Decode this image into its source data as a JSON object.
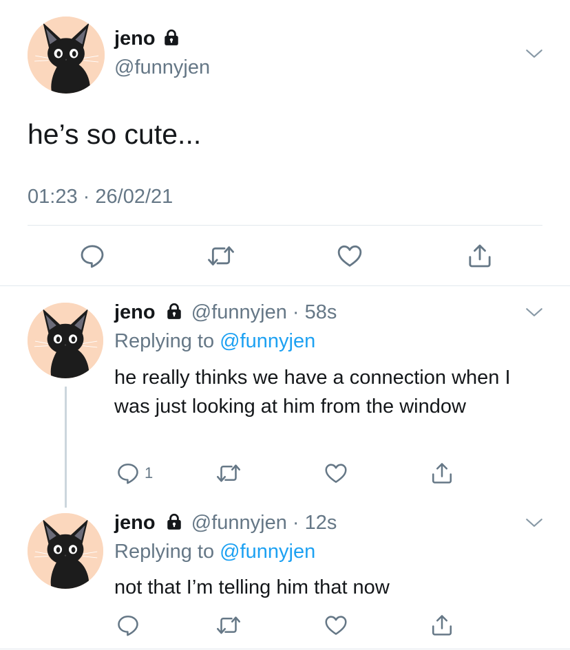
{
  "main_tweet": {
    "author_name": "jeno",
    "handle": "@funnyjen",
    "text": "he’s so cute...",
    "time": "01:23",
    "date": "26/02/21",
    "separator": "·"
  },
  "replies": [
    {
      "author_name": "jeno",
      "handle": "@funnyjen",
      "separator": "·",
      "age": "58s",
      "replying_prefix": "Replying to",
      "replying_handle": "@funnyjen",
      "text": "he really thinks we have a connection when I was just looking at him from the window",
      "reply_count": "1"
    },
    {
      "author_name": "jeno",
      "handle": "@funnyjen",
      "separator": "·",
      "age": "12s",
      "replying_prefix": "Replying to",
      "replying_handle": "@funnyjen",
      "text": "not that I’m telling him that now",
      "reply_count": ""
    }
  ],
  "icons": {
    "reply": "speech-bubble-icon",
    "retweet": "retweet-icon",
    "like": "heart-icon",
    "share": "share-icon",
    "lock": "lock-icon",
    "menu": "chevron-down-icon"
  },
  "colors": {
    "text": "#14171a",
    "muted": "#657786",
    "link": "#1da1f2",
    "divider": "#e1e8ed",
    "avatar_bg": "#fbd7bd"
  }
}
